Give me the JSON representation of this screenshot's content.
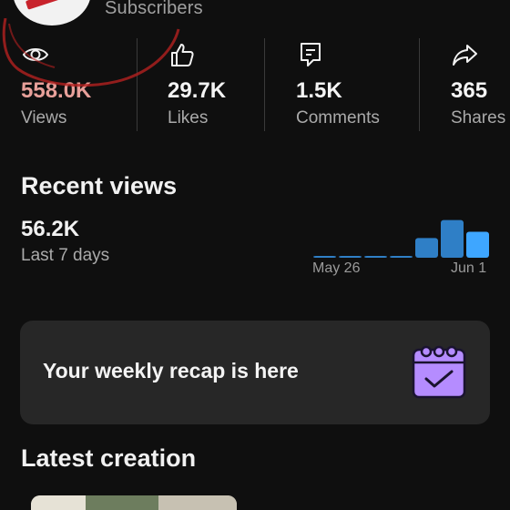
{
  "header": {
    "subscribers_label": "Subscribers"
  },
  "stats": [
    {
      "icon": "eye-icon",
      "value": "558.0K",
      "label": "Views"
    },
    {
      "icon": "thumbs-up-icon",
      "value": "29.7K",
      "label": "Likes"
    },
    {
      "icon": "comment-icon",
      "value": "1.5K",
      "label": "Comments"
    },
    {
      "icon": "share-icon",
      "value": "365",
      "label": "Shares"
    }
  ],
  "recent_views": {
    "title": "Recent views",
    "value": "56.2K",
    "period": "Last 7 days",
    "axis_start": "May 26",
    "axis_end": "Jun 1"
  },
  "recap": {
    "text": "Your weekly recap is here",
    "icon": "calendar-check-icon"
  },
  "latest_creation": {
    "title": "Latest creation"
  },
  "colors": {
    "background": "#0f0f0f",
    "card": "#272727",
    "bar_dark": "#2f7fc6",
    "bar_light": "#3ea6ff",
    "scribble": "#b3201f",
    "recap_icon": "#b58cff"
  },
  "chart_data": {
    "type": "bar",
    "categories": [
      "May 26",
      "",
      "",
      "",
      "",
      "",
      "Jun 1"
    ],
    "values": [
      0.02,
      0.02,
      0.02,
      0.02,
      0.47,
      0.9,
      0.62
    ],
    "xlabel": "",
    "ylabel": ""
  }
}
